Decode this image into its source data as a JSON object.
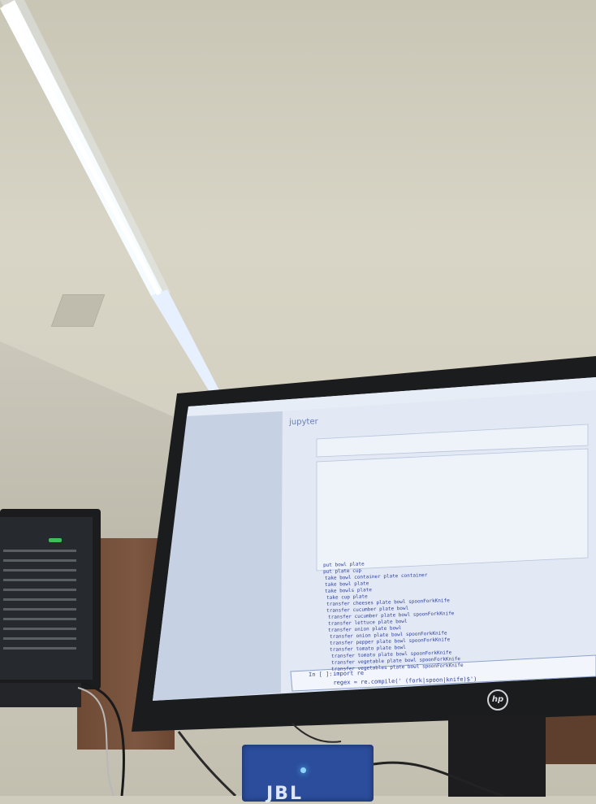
{
  "notebook": {
    "brand": "jupyter",
    "output_lines": [
      "put bowl plate",
      "put plate cup",
      "take bowl container plate container",
      "take bowl plate",
      "take bowls plate",
      "take cup plate",
      "transfer cheeses plate bowl spoonForkKnife",
      "transfer cucumber plate bowl",
      "transfer cucumber plate bowl spoonForkKnife",
      "transfer lettuce plate bowl",
      "transfer onion plate bowl",
      "transfer onion plate bowl spoonForkKnife",
      "transfer pepper plate bowl spoonForkKnife",
      "transfer tomato plate bowl",
      "transfer tomato plate bowl spoonForkKnife",
      "transfer vegetable plate bowl spoonForkKnife",
      "transfer vegetables plate bowl spoonForkKnife"
    ],
    "last_cell": {
      "prompt": "In [ ]:",
      "line1": "import re",
      "line2": "regex = re.compile(' (fork|spoon|knife)$')"
    }
  },
  "device": {
    "label": "JBL"
  },
  "monitor": {
    "brand_logo": "hp"
  },
  "colors": {
    "screen_bg": "#d9e3f2",
    "code_text": "#2e3f9e",
    "output_bg": "#e9eef7",
    "bezel": "#1b1c1e",
    "wall": "#d4d0c1"
  }
}
